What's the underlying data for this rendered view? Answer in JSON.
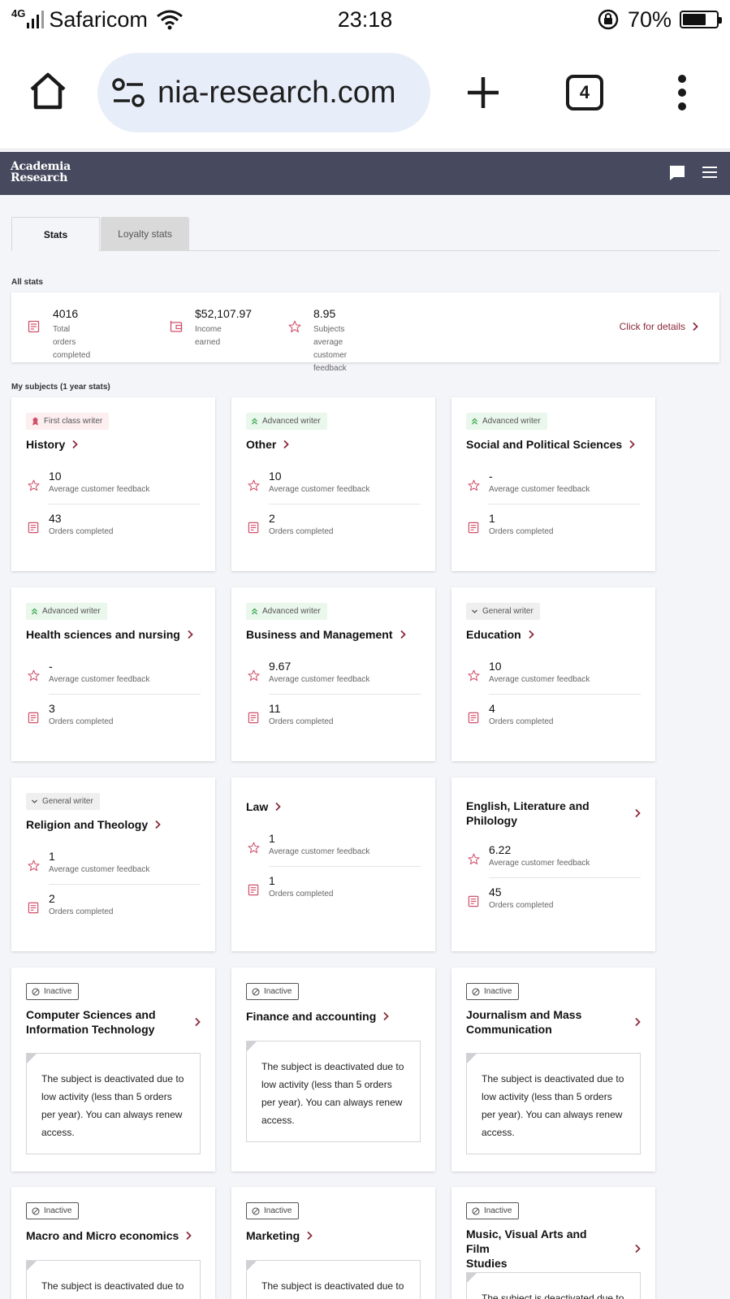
{
  "status_bar": {
    "network": "4G",
    "carrier": "Safaricom",
    "time": "23:18",
    "battery": "70%",
    "battery_level": 0.7
  },
  "browser": {
    "url": "nia-research.com",
    "tab_count": "4"
  },
  "app": {
    "logo_line1": "Academia",
    "logo_line2": "Research"
  },
  "tabs": {
    "stats": "Stats",
    "loyalty": "Loyalty stats"
  },
  "all_stats": {
    "section_label": "All stats",
    "orders": {
      "value": "4016",
      "label_1": "Total orders",
      "label_2": "completed"
    },
    "income": {
      "value": "$52,107.97",
      "label_1": "Income",
      "label_2": "earned"
    },
    "feedback": {
      "value": "8.95",
      "label_1": "Subjects average customer",
      "label_2": "feedback"
    },
    "details_link": "Click for details"
  },
  "subjects_label": "My subjects (1 year stats)",
  "metric_labels": {
    "feedback": "Average customer feedback",
    "orders": "Orders completed"
  },
  "subjects": [
    {
      "badge": "First class writer",
      "title": "History",
      "feedback": "10",
      "orders": "43"
    },
    {
      "badge": "Advanced writer",
      "title": "Other",
      "feedback": "10",
      "orders": "2"
    },
    {
      "badge": "Advanced writer",
      "title": "Social and Political Sciences",
      "feedback": "-",
      "orders": "1"
    },
    {
      "badge": "Advanced writer",
      "title": "Health sciences and nursing",
      "feedback": "-",
      "orders": "3"
    },
    {
      "badge": "Advanced writer",
      "title": "Business and Management",
      "feedback": "9.67",
      "orders": "11"
    },
    {
      "badge": "General writer",
      "title": "Education",
      "feedback": "10",
      "orders": "4"
    },
    {
      "badge": "General writer",
      "title": "Religion and Theology",
      "feedback": "1",
      "orders": "2"
    },
    {
      "badge": "",
      "title": "Law",
      "feedback": "1",
      "orders": "1"
    },
    {
      "badge": "",
      "title_1": "English, Literature and",
      "title_2": "Philology",
      "feedback": "6.22",
      "orders": "45"
    }
  ],
  "inactive_badge": "Inactive",
  "inactive_notice": "The subject is deactivated due to low activity (less than 5 orders per year). You can always renew access.",
  "inactive_subjects": [
    {
      "title_1": "Computer Sciences and",
      "title_2": "Information Technology"
    },
    {
      "title": "Finance and accounting"
    },
    {
      "title_1": "Journalism and Mass",
      "title_2": "Communication"
    },
    {
      "title": "Macro and Micro economics"
    },
    {
      "title": "Marketing"
    },
    {
      "title_1": "Music, Visual Arts and Film",
      "title_2": "Studies"
    }
  ],
  "colors": {
    "header": "#474a5e",
    "accent": "#8a2a3b",
    "icon_pink": "#d0506a",
    "advanced_green": "#3caa52"
  }
}
